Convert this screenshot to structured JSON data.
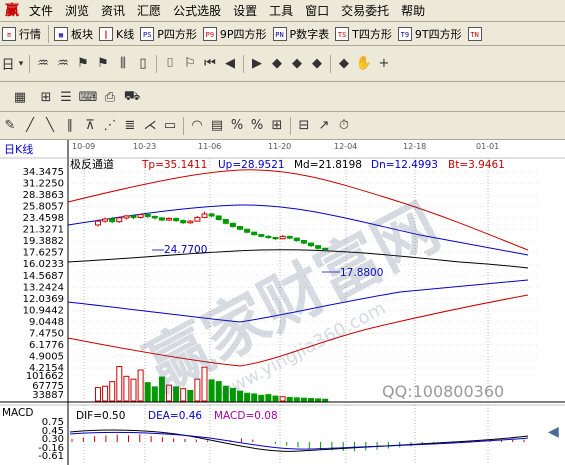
{
  "menu": {
    "logo_glyph": "赢",
    "items": [
      "文件",
      "浏览",
      "资讯",
      "汇愿",
      "公式选股",
      "设置",
      "工具",
      "窗口",
      "交易委托",
      "帮助"
    ]
  },
  "toolbar1": {
    "buttons": [
      {
        "icon": "quote-list-icon",
        "glyph": "≡",
        "label": "行情"
      },
      {
        "icon": "sector-icon",
        "glyph": "▦",
        "label": "板块"
      },
      {
        "icon": "kline-icon",
        "glyph": "┃",
        "label": "K线"
      },
      {
        "icon": "p-square-icon",
        "glyph": "PS",
        "label": "P四方形"
      },
      {
        "icon": "9p-square-icon",
        "glyph": "P9",
        "label": "9P四方形"
      },
      {
        "icon": "p-number-table-icon",
        "glyph": "PN",
        "label": "P数字表"
      },
      {
        "icon": "t-square-icon",
        "glyph": "TS",
        "label": "T四方形"
      },
      {
        "icon": "9t-square-icon",
        "glyph": "T9",
        "label": "9T四方形"
      },
      {
        "icon": "tn-icon",
        "glyph": "TN",
        "label": ""
      }
    ]
  },
  "toolbar2": {
    "period_label": "日",
    "icons": [
      "kline-type-icon",
      "cycle-icon",
      "candle-icon",
      "bar-icon",
      "flag-icon",
      "first-icon",
      "prev-icon",
      "next-icon",
      "last-icon",
      "zoom-in-icon",
      "zoom-out-icon",
      "move-left-icon",
      "move-right-icon",
      "hand-icon",
      "crosshair-icon",
      "draw-icon",
      "settings-icon"
    ]
  },
  "toolbar4": {
    "icons": [
      "pencil-icon",
      "line-icon",
      "ray-icon",
      "parallel-icon",
      "fib-icon",
      "gann-icon",
      "cycle-line-icon",
      "fan-icon",
      "box-icon",
      "arc-icon",
      "table-icon",
      "percent-icon",
      "percent-sign-icon",
      "grid-icon",
      "ruler-icon",
      "arrow-icon",
      "time-icon"
    ]
  },
  "chart_header": {
    "period": "日K线",
    "indicator": "极反通道",
    "tp": "Tp=35.1411",
    "up": "Up=28.9521",
    "md": "Md=21.8198",
    "dn": "Dn=12.4993",
    "bt": "Bt=3.9461"
  },
  "date_labels": [
    "10-09",
    "10-23",
    "11-06",
    "11-20",
    "12-04",
    "12-18",
    "01-01"
  ],
  "price_axis": [
    "34.3475",
    "31.2250",
    "28.3863",
    "25.8057",
    "23.4598",
    "21.3271",
    "19.3882",
    "17.6257",
    "16.0233",
    "14.5687",
    "13.2424",
    "12.0369",
    "10.9442",
    "9.0448",
    "7.4750",
    "6.1776",
    "4.9005",
    "4.2154"
  ],
  "volume_axis": [
    "101662",
    "67775",
    "33887"
  ],
  "annotations": {
    "high_price": "24.7700",
    "low_price": "17.8800",
    "watermark_text": "赢家财富网",
    "watermark_url": "www.yingjia360.com",
    "qq": "QQ:100800360"
  },
  "macd": {
    "label": "MACD",
    "dif": "DIF=0.50",
    "dea": "DEA=0.46",
    "macd": "MACD=0.08",
    "axis": [
      "0.75",
      "0.45",
      "0.30",
      "-0.16",
      "-0.61"
    ]
  },
  "colors": {
    "toolbar_bg": "#ece9d8",
    "red_channel": "#cc0000",
    "blue_channel": "#0000cc",
    "mid_line": "#000000",
    "down_candle": "#009900",
    "up_candle": "#cc0000",
    "header_blue": "#0000cc",
    "header_red": "#cc0000"
  },
  "chart_data": {
    "type": "line",
    "candles": [
      {
        "o": 22.2,
        "c": 22.9,
        "h": 23.2,
        "l": 21.9
      },
      {
        "o": 22.9,
        "c": 23.3,
        "h": 23.6,
        "l": 22.6
      },
      {
        "o": 23.3,
        "c": 22.8,
        "h": 23.7,
        "l": 22.5
      },
      {
        "o": 22.8,
        "c": 23.5,
        "h": 23.8,
        "l": 22.6
      },
      {
        "o": 23.5,
        "c": 23.9,
        "h": 24.1,
        "l": 23.2
      },
      {
        "o": 23.9,
        "c": 23.6,
        "h": 24.2,
        "l": 23.3
      },
      {
        "o": 23.6,
        "c": 24.2,
        "h": 24.4,
        "l": 23.4
      },
      {
        "o": 24.2,
        "c": 23.8,
        "h": 24.5,
        "l": 23.5
      },
      {
        "o": 23.8,
        "c": 23.5,
        "h": 24.0,
        "l": 23.2
      },
      {
        "o": 23.5,
        "c": 23.1,
        "h": 23.7,
        "l": 22.9
      },
      {
        "o": 23.1,
        "c": 23.4,
        "h": 23.6,
        "l": 22.9
      },
      {
        "o": 23.4,
        "c": 23.0,
        "h": 23.6,
        "l": 22.7
      },
      {
        "o": 23.0,
        "c": 22.6,
        "h": 23.2,
        "l": 22.4
      },
      {
        "o": 22.6,
        "c": 22.9,
        "h": 23.1,
        "l": 22.4
      },
      {
        "o": 22.9,
        "c": 23.6,
        "h": 23.9,
        "l": 22.8
      },
      {
        "o": 23.6,
        "c": 24.3,
        "h": 24.77,
        "l": 23.5
      },
      {
        "o": 24.3,
        "c": 23.9,
        "h": 24.5,
        "l": 23.6
      },
      {
        "o": 23.9,
        "c": 23.2,
        "h": 24.0,
        "l": 23.0
      },
      {
        "o": 23.2,
        "c": 22.5,
        "h": 23.3,
        "l": 22.3
      },
      {
        "o": 22.5,
        "c": 21.9,
        "h": 22.6,
        "l": 21.7
      },
      {
        "o": 21.9,
        "c": 21.4,
        "h": 22.0,
        "l": 21.2
      },
      {
        "o": 21.4,
        "c": 20.9,
        "h": 21.5,
        "l": 20.7
      },
      {
        "o": 20.9,
        "c": 20.5,
        "h": 21.0,
        "l": 20.3
      },
      {
        "o": 20.5,
        "c": 20.2,
        "h": 20.6,
        "l": 20.0
      },
      {
        "o": 20.2,
        "c": 20.0,
        "h": 20.4,
        "l": 19.8
      },
      {
        "o": 20.0,
        "c": 19.8,
        "h": 20.1,
        "l": 19.6
      },
      {
        "o": 19.8,
        "c": 20.2,
        "h": 20.4,
        "l": 19.7
      },
      {
        "o": 20.2,
        "c": 19.9,
        "h": 20.3,
        "l": 19.7
      },
      {
        "o": 19.9,
        "c": 19.5,
        "h": 20.0,
        "l": 19.3
      },
      {
        "o": 19.5,
        "c": 19.1,
        "h": 19.6,
        "l": 18.9
      },
      {
        "o": 19.1,
        "c": 18.7,
        "h": 19.2,
        "l": 18.5
      },
      {
        "o": 18.7,
        "c": 18.3,
        "h": 18.8,
        "l": 18.1
      },
      {
        "o": 18.3,
        "c": 18.1,
        "h": 18.4,
        "l": 17.88
      }
    ],
    "volumes": [
      {
        "v": 38000,
        "up": true
      },
      {
        "v": 42000,
        "up": true
      },
      {
        "v": 55000,
        "up": true
      },
      {
        "v": 98000,
        "up": true
      },
      {
        "v": 70000,
        "up": true
      },
      {
        "v": 62000,
        "up": true
      },
      {
        "v": 88000,
        "up": true
      },
      {
        "v": 52000,
        "up": false
      },
      {
        "v": 40000,
        "up": false
      },
      {
        "v": 68000,
        "up": false
      },
      {
        "v": 45000,
        "up": true
      },
      {
        "v": 40000,
        "up": false
      },
      {
        "v": 35000,
        "up": true
      },
      {
        "v": 30000,
        "up": false
      },
      {
        "v": 62000,
        "up": true
      },
      {
        "v": 96000,
        "up": true
      },
      {
        "v": 60000,
        "up": false
      },
      {
        "v": 55000,
        "up": false
      },
      {
        "v": 42000,
        "up": false
      },
      {
        "v": 36000,
        "up": false
      },
      {
        "v": 28000,
        "up": false
      },
      {
        "v": 22000,
        "up": false
      },
      {
        "v": 20000,
        "up": false
      },
      {
        "v": 16000,
        "up": false
      },
      {
        "v": 18000,
        "up": false
      },
      {
        "v": 14000,
        "up": false
      },
      {
        "v": 12000,
        "up": true
      },
      {
        "v": 10000,
        "up": false
      },
      {
        "v": 9000,
        "up": false
      },
      {
        "v": 8000,
        "up": false
      },
      {
        "v": 7000,
        "up": false
      },
      {
        "v": 6000,
        "up": false
      },
      {
        "v": 5000,
        "up": false
      }
    ],
    "macd_bars": [
      0.1,
      0.15,
      0.2,
      0.22,
      0.25,
      0.22,
      0.26,
      0.2,
      0.16,
      0.12,
      0.1,
      0.08,
      0.05,
      0.02,
      0.06,
      0.12,
      0.08,
      0.0,
      -0.06,
      -0.12,
      -0.18,
      -0.22,
      -0.26,
      -0.28,
      -0.3,
      -0.3,
      -0.28,
      -0.26,
      -0.22,
      -0.18,
      -0.14,
      -0.1,
      -0.06,
      -0.02,
      0.0,
      0.02,
      0.04,
      0.05,
      0.06,
      0.07,
      0.08
    ]
  }
}
